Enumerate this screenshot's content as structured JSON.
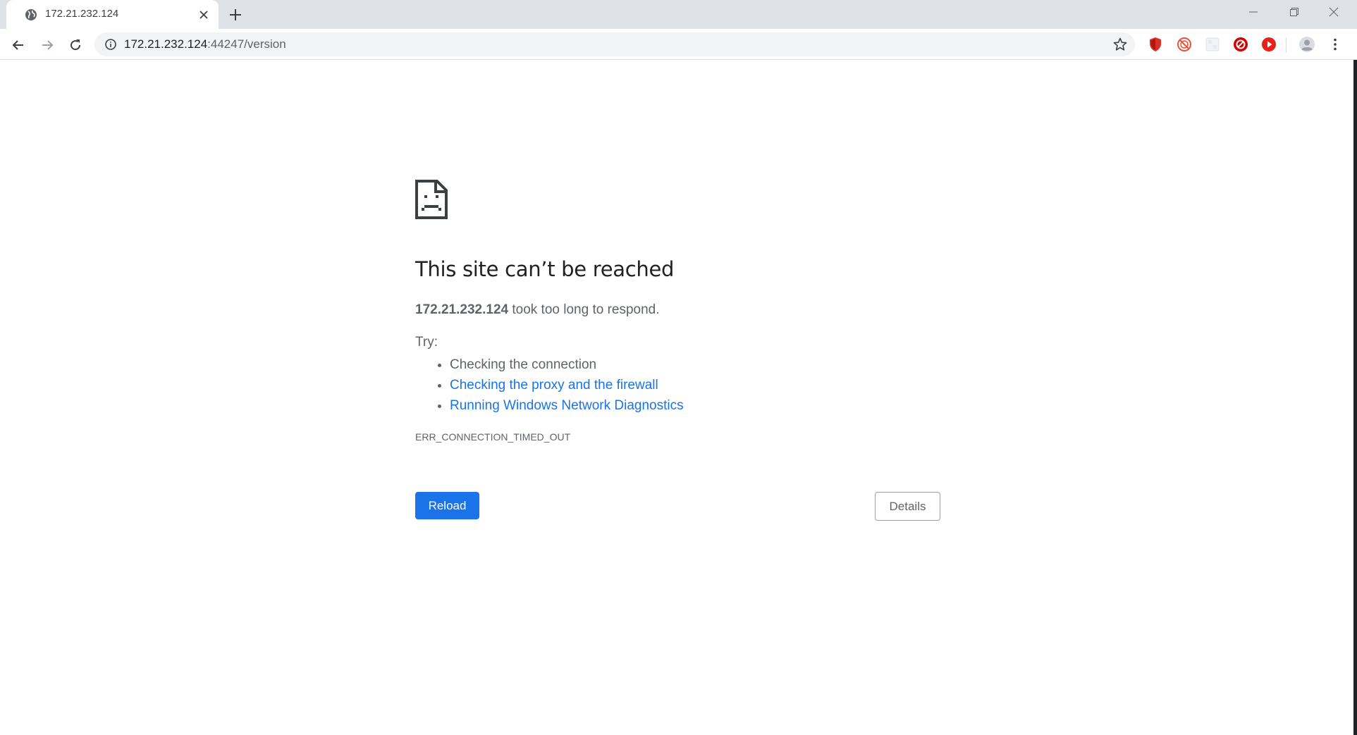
{
  "tab": {
    "title": "172.21.232.124",
    "favicon": "globe-icon",
    "close": "close-icon"
  },
  "new_tab": "plus-icon",
  "window_controls": [
    "minimize-icon",
    "restore-icon",
    "close-icon"
  ],
  "toolbar": {
    "back": "arrow-left-icon",
    "forward": "arrow-right-icon",
    "reload": "reload-icon"
  },
  "omnibox": {
    "host": "172.21.232.124",
    "path": ":44247/version",
    "info_icon": "info-icon",
    "bookmark_icon": "star-icon"
  },
  "extensions": [
    {
      "name": "shield-extension-icon",
      "color": "#d93025"
    },
    {
      "name": "circle-slash-extension-icon",
      "color": "#e8553e"
    },
    {
      "name": "blank-extension-icon",
      "color": "#e0e0e0"
    },
    {
      "name": "block-extension-icon",
      "color": "#d50000"
    },
    {
      "name": "play-extension-icon",
      "color": "#e62117"
    }
  ],
  "profile_icon": "avatar-icon",
  "menu_icon": "kebab-menu-icon",
  "error": {
    "icon": "sad-page-icon",
    "heading": "This site can’t be reached",
    "summary_host": "172.21.232.124",
    "summary_rest": " took too long to respond.",
    "try_label": "Try:",
    "suggestions": [
      "Checking the connection",
      "Checking the proxy and the firewall",
      "Running Windows Network Diagnostics"
    ],
    "code": "ERR_CONNECTION_TIMED_OUT",
    "reload_label": "Reload",
    "details_label": "Details"
  },
  "colors": {
    "accent": "#1a73e8",
    "text": "#5f6368",
    "heading": "#202124"
  }
}
